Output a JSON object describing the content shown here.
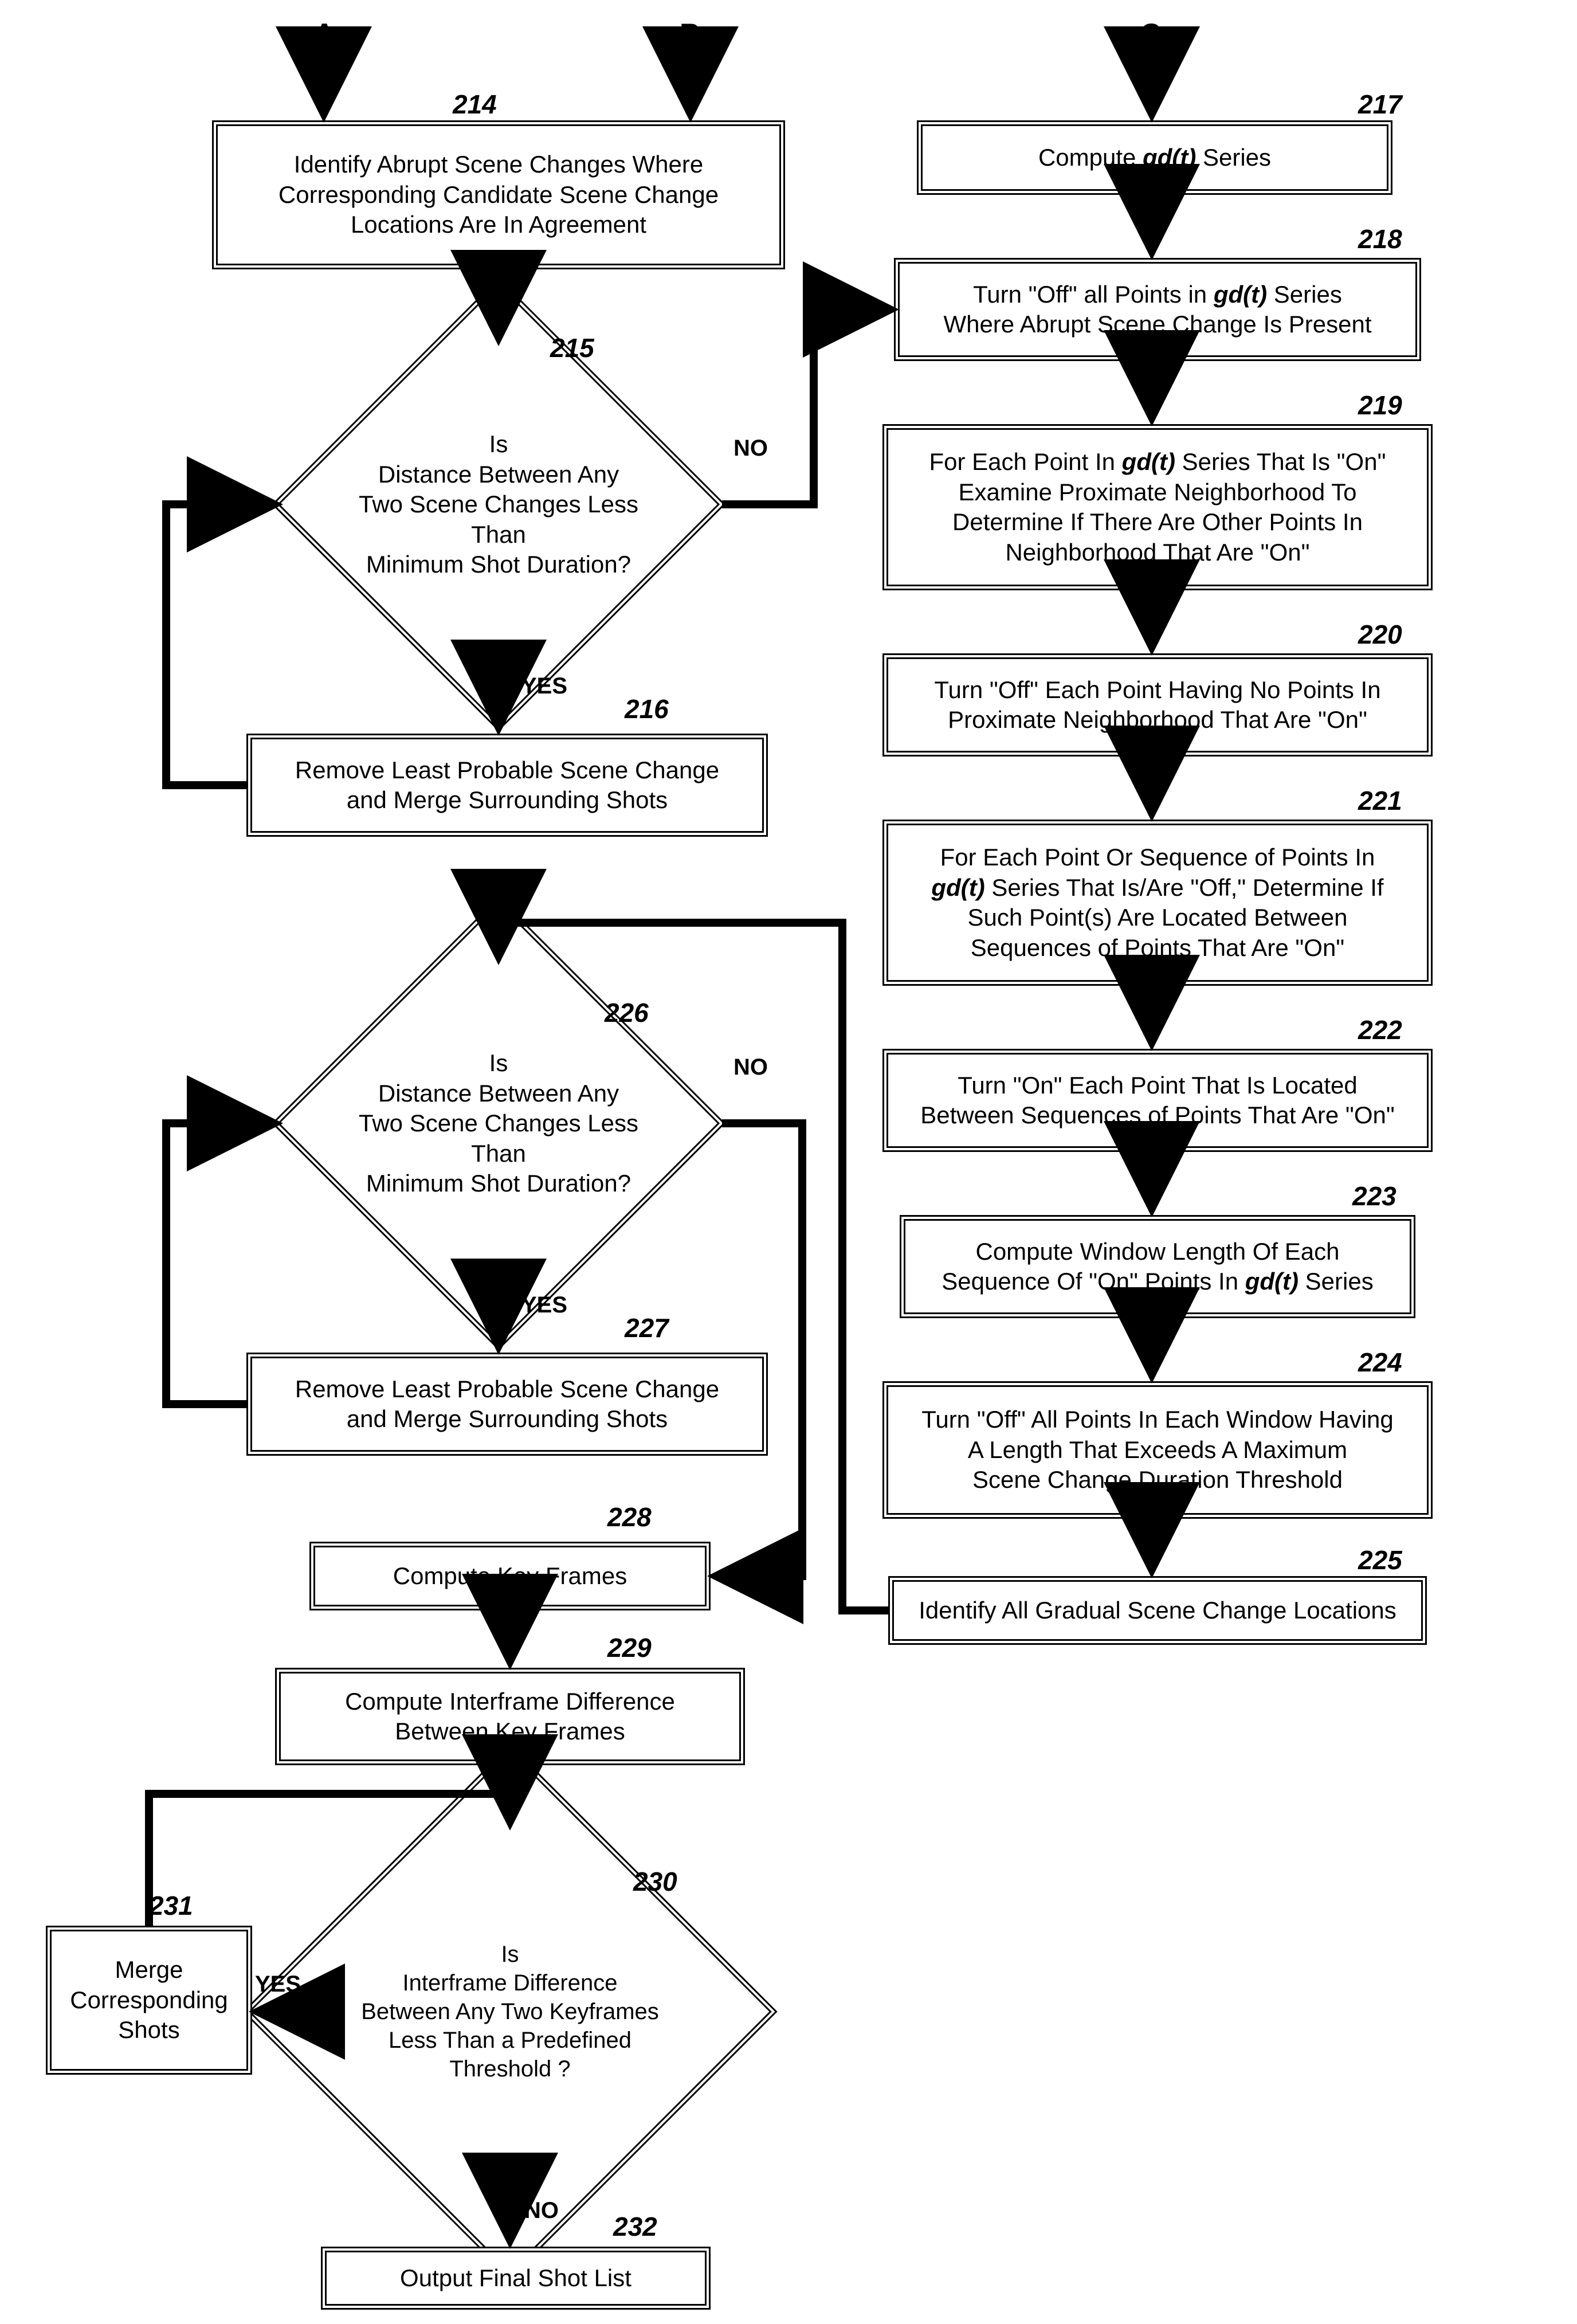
{
  "entries": {
    "a": "A",
    "b": "B",
    "c": "C"
  },
  "labels": {
    "n214": "214",
    "n215": "215",
    "n216": "216",
    "n217": "217",
    "n218": "218",
    "n219": "219",
    "n220": "220",
    "n221": "221",
    "n222": "222",
    "n223": "223",
    "n224": "224",
    "n225": "225",
    "n226": "226",
    "n227": "227",
    "n228": "228",
    "n229": "229",
    "n230": "230",
    "n231": "231",
    "n232": "232"
  },
  "yn": {
    "yes": "YES",
    "no": "NO"
  },
  "box214": {
    "l1": "Identify Abrupt Scene Changes Where",
    "l2": "Corresponding Candidate Scene Change",
    "l3": "Locations Are In Agreement"
  },
  "d215": {
    "l1": "Is",
    "l2": "Distance Between Any",
    "l3a": "Two Scene Changes ",
    "l3b": "Less Than",
    "l4": "Minimum Shot Duration?"
  },
  "box216": {
    "l1": "Remove Least Probable Scene Change",
    "l2": "and Merge Surrounding Shots"
  },
  "box217": {
    "l1a": "Compute ",
    "l1b": "gd(t)",
    "l1c": " Series"
  },
  "box218": {
    "l1a": "Turn \"Off\" all Points in ",
    "l1b": "gd(t)",
    "l1c": " Series",
    "l2": "Where Abrupt Scene Change Is Present"
  },
  "box219": {
    "l1a": "For Each Point In ",
    "l1b": "gd(t)",
    "l1c": " Series That Is \"On\"",
    "l2": "Examine Proximate Neighborhood To",
    "l3": "Determine If There Are Other Points In",
    "l4": "Neighborhood That Are \"On\""
  },
  "box220": {
    "l1": "Turn \"Off\" Each Point Having No Points In",
    "l2": "Proximate Neighborhood That Are \"On\""
  },
  "box221": {
    "l1": "For Each Point Or Sequence of Points In",
    "l2a": "gd(t)",
    "l2b": " Series That Is/Are \"Off,\" Determine If",
    "l3": "Such Point(s) Are Located Between",
    "l4": "Sequences of Points That Are \"On\""
  },
  "box222": {
    "l1": "Turn \"On\" Each Point That Is Located",
    "l2": "Between Sequences of Points That Are \"On\""
  },
  "box223": {
    "l1": "Compute Window Length Of Each",
    "l2a": "Sequence Of \"On\" Points In ",
    "l2b": "gd(t)",
    "l2c": " Series"
  },
  "box224": {
    "l1": "Turn \"Off\" All Points In Each Window Having",
    "l2": "A Length That Exceeds A Maximum",
    "l3": "Scene Change Duration Threshold"
  },
  "box225": {
    "l1": "Identify All Gradual Scene Change Locations"
  },
  "d226": {
    "l1": "Is",
    "l2": "Distance Between Any",
    "l3a": "Two Scene Changes ",
    "l3b": "Less Than",
    "l4": "Minimum Shot Duration?"
  },
  "box227": {
    "l1": "Remove Least Probable Scene Change",
    "l2": "and Merge Surrounding Shots"
  },
  "box228": {
    "l1": "Compute Key Frames"
  },
  "box229": {
    "l1": "Compute Interframe Difference",
    "l2": "Between Key Frames"
  },
  "d230": {
    "l1": "Is",
    "l2": "Interframe Difference",
    "l3": "Between Any Two Keyframes",
    "l4a": "Less Than",
    "l4b": " a Predefined",
    "l5": "Threshold ?"
  },
  "box231": {
    "l1": "Merge",
    "l2": "Corresponding",
    "l3": "Shots"
  },
  "box232": {
    "l1": "Output Final Shot List"
  },
  "chart_data": {
    "type": "flowchart",
    "entry_points": [
      "A",
      "B",
      "C"
    ],
    "nodes": [
      {
        "id": 214,
        "type": "process",
        "text": "Identify Abrupt Scene Changes Where Corresponding Candidate Scene Change Locations Are In Agreement"
      },
      {
        "id": 215,
        "type": "decision",
        "text": "Is Distance Between Any Two Scene Changes Less Than Minimum Shot Duration?"
      },
      {
        "id": 216,
        "type": "process",
        "text": "Remove Least Probable Scene Change and Merge Surrounding Shots"
      },
      {
        "id": 217,
        "type": "process",
        "text": "Compute gd(t) Series"
      },
      {
        "id": 218,
        "type": "process",
        "text": "Turn \"Off\" all Points in gd(t) Series Where Abrupt Scene Change Is Present"
      },
      {
        "id": 219,
        "type": "process",
        "text": "For Each Point In gd(t) Series That Is \"On\" Examine Proximate Neighborhood To Determine If There Are Other Points In Neighborhood That Are \"On\""
      },
      {
        "id": 220,
        "type": "process",
        "text": "Turn \"Off\" Each Point Having No Points In Proximate Neighborhood That Are \"On\""
      },
      {
        "id": 221,
        "type": "process",
        "text": "For Each Point Or Sequence of Points In gd(t) Series That Is/Are \"Off,\" Determine If Such Point(s) Are Located Between Sequences of Points That Are \"On\""
      },
      {
        "id": 222,
        "type": "process",
        "text": "Turn \"On\" Each Point That Is Located Between Sequences of Points That Are \"On\""
      },
      {
        "id": 223,
        "type": "process",
        "text": "Compute Window Length Of Each Sequence Of \"On\" Points In gd(t) Series"
      },
      {
        "id": 224,
        "type": "process",
        "text": "Turn \"Off\" All Points In Each Window Having A Length That Exceeds A Maximum Scene Change Duration Threshold"
      },
      {
        "id": 225,
        "type": "process",
        "text": "Identify All Gradual Scene Change Locations"
      },
      {
        "id": 226,
        "type": "decision",
        "text": "Is Distance Between Any Two Scene Changes Less Than Minimum Shot Duration?"
      },
      {
        "id": 227,
        "type": "process",
        "text": "Remove Least Probable Scene Change and Merge Surrounding Shots"
      },
      {
        "id": 228,
        "type": "process",
        "text": "Compute Key Frames"
      },
      {
        "id": 229,
        "type": "process",
        "text": "Compute Interframe Difference Between Key Frames"
      },
      {
        "id": 230,
        "type": "decision",
        "text": "Is Interframe Difference Between Any Two Keyframes Less Than a Predefined Threshold?"
      },
      {
        "id": 231,
        "type": "process",
        "text": "Merge Corresponding Shots"
      },
      {
        "id": 232,
        "type": "process",
        "text": "Output Final Shot List"
      }
    ],
    "edges": [
      {
        "from": "A",
        "to": 214
      },
      {
        "from": "B",
        "to": 214
      },
      {
        "from": "C",
        "to": 217
      },
      {
        "from": 214,
        "to": 215
      },
      {
        "from": 215,
        "to": 216,
        "label": "YES"
      },
      {
        "from": 216,
        "to": 215
      },
      {
        "from": 215,
        "to": 218,
        "label": "NO"
      },
      {
        "from": 217,
        "to": 218
      },
      {
        "from": 218,
        "to": 219
      },
      {
        "from": 219,
        "to": 220
      },
      {
        "from": 220,
        "to": 221
      },
      {
        "from": 221,
        "to": 222
      },
      {
        "from": 222,
        "to": 223
      },
      {
        "from": 223,
        "to": 224
      },
      {
        "from": 224,
        "to": 225
      },
      {
        "from": 225,
        "to": 226
      },
      {
        "from": 226,
        "to": 227,
        "label": "YES"
      },
      {
        "from": 227,
        "to": 226
      },
      {
        "from": 226,
        "to": 228,
        "label": "NO"
      },
      {
        "from": 228,
        "to": 229
      },
      {
        "from": 229,
        "to": 230
      },
      {
        "from": 230,
        "to": 231,
        "label": "YES"
      },
      {
        "from": 231,
        "to": 230
      },
      {
        "from": 230,
        "to": 232,
        "label": "NO"
      }
    ]
  }
}
